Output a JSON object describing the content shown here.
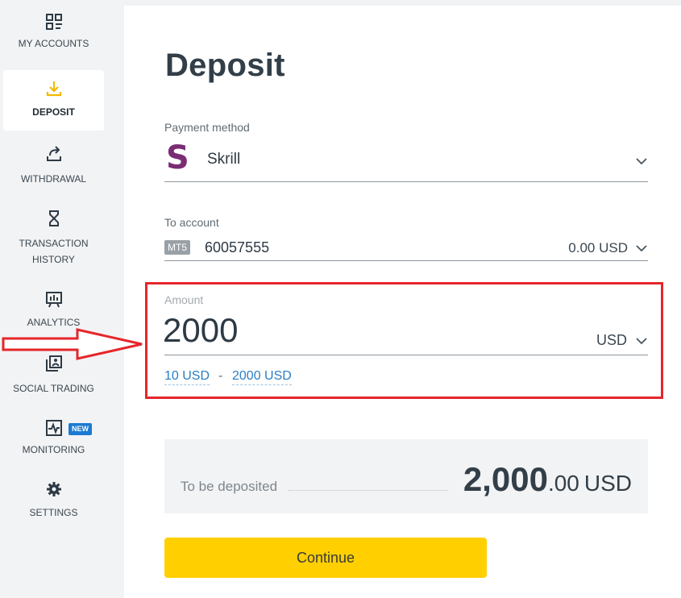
{
  "sidebar": {
    "items": [
      {
        "label": "MY ACCOUNTS",
        "icon": "accounts-grid-icon"
      },
      {
        "label": "DEPOSIT",
        "icon": "download-icon",
        "active": true
      },
      {
        "label": "WITHDRAWAL",
        "icon": "upload-share-icon"
      },
      {
        "label": "TRANSACTION\nHISTORY",
        "icon": "hourglass-icon"
      },
      {
        "label": "ANALYTICS",
        "icon": "chart-board-icon"
      },
      {
        "label": "SOCIAL TRADING",
        "icon": "social-trading-icon"
      },
      {
        "label": "MONITORING",
        "icon": "monitor-pulse-icon",
        "badge": "NEW"
      },
      {
        "label": "SETTINGS",
        "icon": "gear-icon"
      }
    ]
  },
  "main": {
    "title": "Deposit",
    "payment_method": {
      "label": "Payment method",
      "logo_letter": "S",
      "value": "Skrill"
    },
    "to_account": {
      "label": "To account",
      "badge": "MT5",
      "number": "60057555",
      "balance": "0.00 USD"
    },
    "amount": {
      "label": "Amount",
      "value": "2000",
      "currency": "USD",
      "min_limit": "10 USD",
      "separator": "-",
      "max_limit": "2000 USD"
    },
    "summary": {
      "label": "To be deposited",
      "amount_int": "2,000",
      "amount_dec": ".00",
      "currency": "USD"
    },
    "continue_label": "Continue"
  },
  "colors": {
    "accent_yellow": "#ffcf00",
    "skrill_purple": "#7a2d74",
    "annotation_red": "#e5262b",
    "link_blue": "#2a7fc4"
  }
}
